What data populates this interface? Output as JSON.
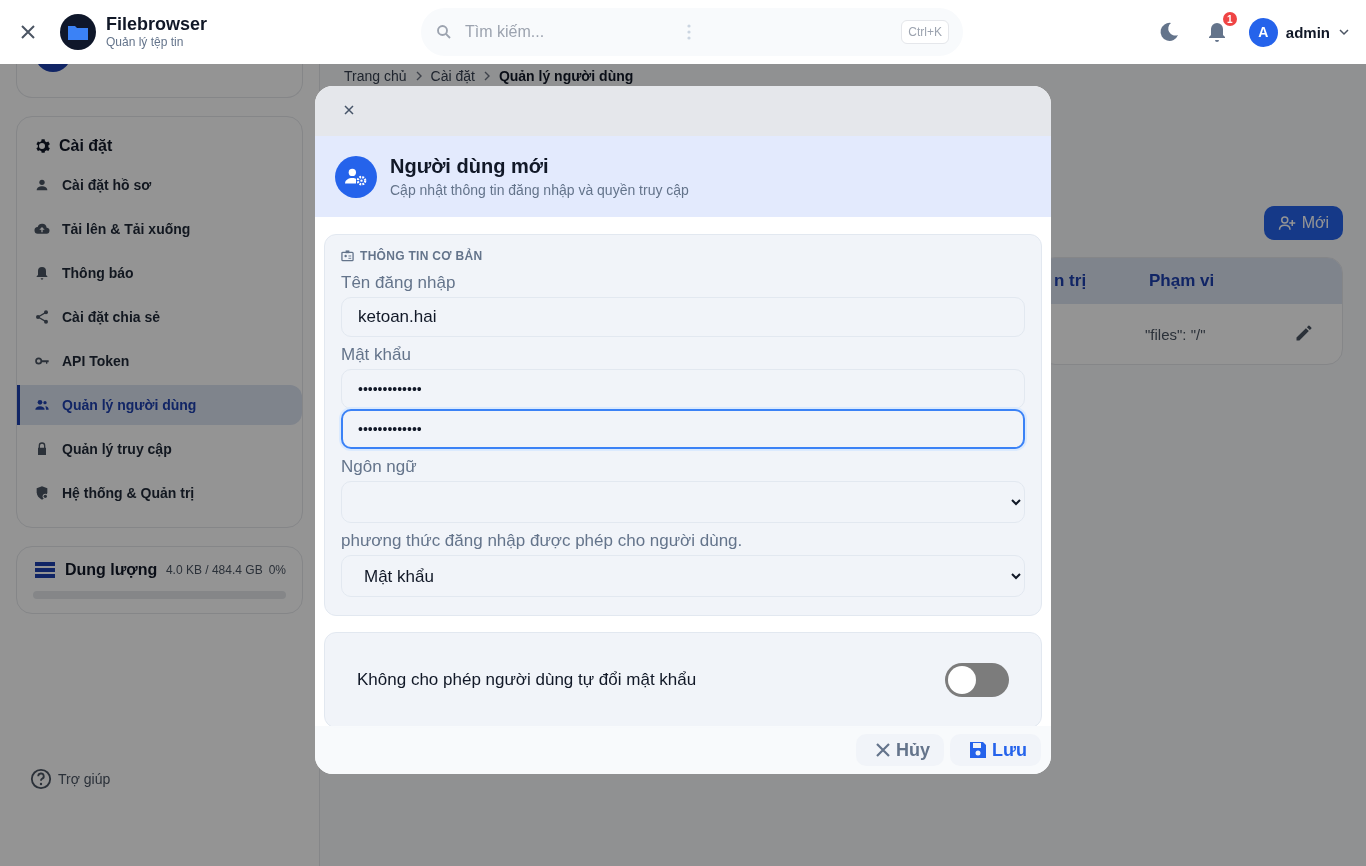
{
  "header": {
    "title": "Filebrowser",
    "subtitle": "Quản lý tệp tin",
    "search": {
      "placeholder": "Tìm kiếm...",
      "shortcut": "Ctrl+K"
    },
    "notifications": "1",
    "user": {
      "initial": "A",
      "name": "admin"
    }
  },
  "breadcrumb": [
    "Trang chủ",
    "Cài đặt",
    "Quản lý người dùng"
  ],
  "sidebar": {
    "settings": {
      "title": "Cài đặt",
      "items": [
        {
          "label": "Cài đặt hồ sơ",
          "selected": false
        },
        {
          "label": "Tải lên & Tải xuống",
          "selected": false
        },
        {
          "label": "Thông báo",
          "selected": false
        },
        {
          "label": "Cài đặt chia sẻ",
          "selected": false
        },
        {
          "label": "API Token",
          "selected": false
        },
        {
          "label": "Quản lý người dùng",
          "selected": true
        },
        {
          "label": "Quản lý truy cập",
          "selected": false
        },
        {
          "label": "Hệ thống & Quản trị",
          "selected": false
        }
      ]
    },
    "storage": {
      "title": "Dung lượng",
      "usage": "4.0 KB / 484.4 GB",
      "percent": "0%",
      "level": 0
    },
    "help": "Trợ giúp"
  },
  "users_table": {
    "new_button": "Mới",
    "columns": [
      "n trị",
      "Phạm vi"
    ],
    "rows": [
      {
        "scope": "\"files\": \"/\""
      }
    ]
  },
  "modal": {
    "title": "Người dùng mới",
    "subtitle": "Cập nhật thông tin đăng nhập và quyền truy cập",
    "section": {
      "title": "THÔNG TIN CƠ BẢN",
      "fields": [
        {
          "kind": "text",
          "label": "Tên đăng nhập",
          "value": "ketoan.hai",
          "focused": false
        },
        {
          "kind": "password",
          "label": "Mật khẩu",
          "value": "•••••••••••••",
          "focused": false
        },
        {
          "kind": "password",
          "value": "•••••••••••••",
          "focused": true
        },
        {
          "kind": "select",
          "label": "Ngôn ngữ"
        },
        {
          "kind": "select",
          "label": "phương thức đăng nhập được phép cho người dùng.",
          "value": "Mật khẩu"
        }
      ]
    },
    "toggles": [
      {
        "label": "Không cho phép người dùng tự đổi mật khẩu",
        "on": false
      }
    ],
    "buttons": [
      {
        "kind": "cancel",
        "label": "Hủy"
      },
      {
        "kind": "save",
        "label": "Lưu"
      }
    ]
  }
}
